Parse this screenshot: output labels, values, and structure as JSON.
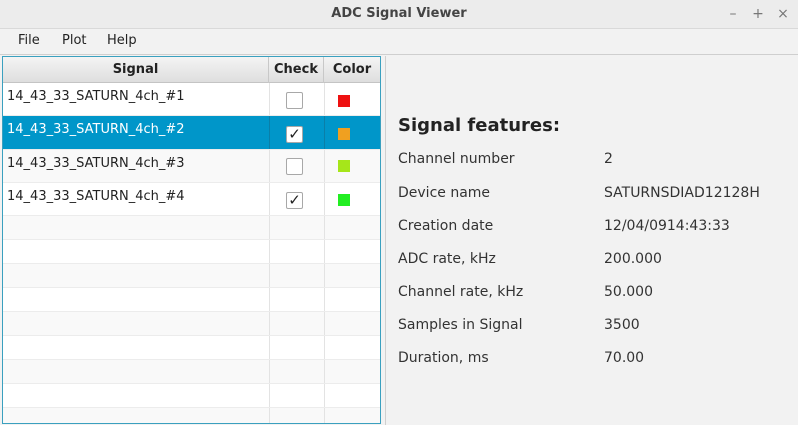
{
  "window": {
    "title": "ADC Signal Viewer",
    "controls": [
      "–",
      "+",
      "×"
    ]
  },
  "menu": {
    "file": "File",
    "plot": "Plot",
    "help": "Help"
  },
  "table": {
    "headers": {
      "signal": "Signal",
      "check": "Check",
      "color": "Color"
    },
    "rows": [
      {
        "signal": "14_43_33_SATURN_4ch_#1",
        "checked": false,
        "color": "#ee1111",
        "selected": false
      },
      {
        "signal": "14_43_33_SATURN_4ch_#2",
        "checked": true,
        "color": "#f0a020",
        "selected": true
      },
      {
        "signal": "14_43_33_SATURN_4ch_#3",
        "checked": false,
        "color": "#a6e61a",
        "selected": false
      },
      {
        "signal": "14_43_33_SATURN_4ch_#4",
        "checked": true,
        "color": "#22ee22",
        "selected": false
      }
    ]
  },
  "features": {
    "title": "Signal features:",
    "items": [
      {
        "label": "Channel number",
        "value": "2"
      },
      {
        "label": "Device name",
        "value": "SATURNSDIAD12128H"
      },
      {
        "label": "Creation date",
        "value": "12/04/0914:43:33"
      },
      {
        "label": "ADC rate, kHz",
        "value": "200.000"
      },
      {
        "label": "Channel rate, kHz",
        "value": "50.000"
      },
      {
        "label": "Samples in Signal",
        "value": "3500"
      },
      {
        "label": "Duration, ms",
        "value": "70.00"
      }
    ]
  }
}
